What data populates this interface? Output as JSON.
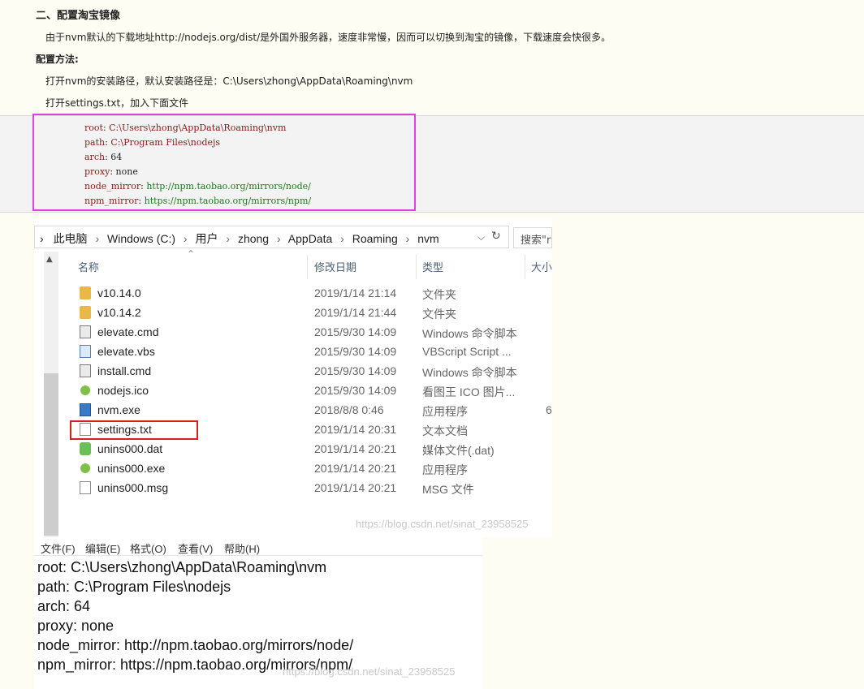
{
  "article": {
    "heading": "二、配置淘宝镜像",
    "intro": "由于nvm默认的下载地址http://nodejs.org/dist/是外国外服务器，速度非常慢，因而可以切换到淘宝的镜像，下载速度会快很多。",
    "method_label": "配置方法:",
    "step1": "打开nvm的安装路径，默认安装路径是：C:\\Users\\zhong\\AppData\\Roaming\\nvm",
    "step2": "打开settings.txt，加入下面文件"
  },
  "code_block": {
    "lines": [
      {
        "key": "root",
        "sep": ": ",
        "value": "C:\\Users\\zhong\\AppData\\Roaming\\nvm"
      },
      {
        "key": "path",
        "sep": ": ",
        "value": "C:\\Program Files\\nodejs"
      },
      {
        "key": "arch",
        "sep": ": ",
        "value": "64"
      },
      {
        "key": "proxy",
        "sep": ": ",
        "value": "none"
      },
      {
        "key": "node_mirror",
        "sep": ": ",
        "value": "http://npm.taobao.org/mirrors/node/"
      },
      {
        "key": "npm_mirror",
        "sep": ": ",
        "value": "https://npm.taobao.org/mirrors/npm/"
      }
    ],
    "highlight_color": "#e040e0"
  },
  "explorer": {
    "breadcrumb": [
      "此电脑",
      "Windows (C:)",
      "用户",
      "zhong",
      "AppData",
      "Roaming",
      "nvm"
    ],
    "breadcrumb_lead": "›",
    "search_placeholder": "搜索\"r",
    "columns": {
      "name": "名称",
      "date": "修改日期",
      "type": "类型",
      "size": "大小"
    },
    "files": [
      {
        "name": "v10.14.0",
        "date": "2019/1/14 21:14",
        "type": "文件夹",
        "size": "",
        "icon": "folder-icon"
      },
      {
        "name": "v10.14.2",
        "date": "2019/1/14 21:44",
        "type": "文件夹",
        "size": "",
        "icon": "folder-icon"
      },
      {
        "name": "elevate.cmd",
        "date": "2015/9/30 14:09",
        "type": "Windows 命令脚本",
        "size": "",
        "icon": "cmd-file-icon"
      },
      {
        "name": "elevate.vbs",
        "date": "2015/9/30 14:09",
        "type": "VBScript Script ...",
        "size": "",
        "icon": "vbs-file-icon"
      },
      {
        "name": "install.cmd",
        "date": "2015/9/30 14:09",
        "type": "Windows 命令脚本",
        "size": "",
        "icon": "cmd-file-icon"
      },
      {
        "name": "nodejs.ico",
        "date": "2015/9/30 14:09",
        "type": "看图王 ICO 图片...",
        "size": "",
        "icon": "nodejs-icon"
      },
      {
        "name": "nvm.exe",
        "date": "2018/8/8 0:46",
        "type": "应用程序",
        "size": "6",
        "icon": "exe-icon"
      },
      {
        "name": "settings.txt",
        "date": "2019/1/14 20:31",
        "type": "文本文档",
        "size": "",
        "icon": "text-file-icon"
      },
      {
        "name": "unins000.dat",
        "date": "2019/1/14 20:21",
        "type": "媒体文件(.dat)",
        "size": "",
        "icon": "dat-file-icon"
      },
      {
        "name": "unins000.exe",
        "date": "2019/1/14 20:21",
        "type": "应用程序",
        "size": "",
        "icon": "nodejs-icon"
      },
      {
        "name": "unins000.msg",
        "date": "2019/1/14 20:21",
        "type": "MSG 文件",
        "size": "",
        "icon": "text-file-icon"
      }
    ],
    "highlight_color": "#d91e1e",
    "watermark": "https://blog.csdn.net/sinat_23958525"
  },
  "notepad": {
    "menu": [
      "文件(F)",
      "编辑(E)",
      "格式(O)",
      "查看(V)",
      "帮助(H)"
    ],
    "lines": [
      "root: C:\\Users\\zhong\\AppData\\Roaming\\nvm",
      "path: C:\\Program Files\\nodejs",
      "arch: 64",
      "proxy: none",
      "node_mirror: http://npm.taobao.org/mirrors/node/",
      "npm_mirror: https://npm.taobao.org/mirrors/npm/"
    ],
    "watermark": "https://blog.csdn.net/sinat_23958525"
  }
}
